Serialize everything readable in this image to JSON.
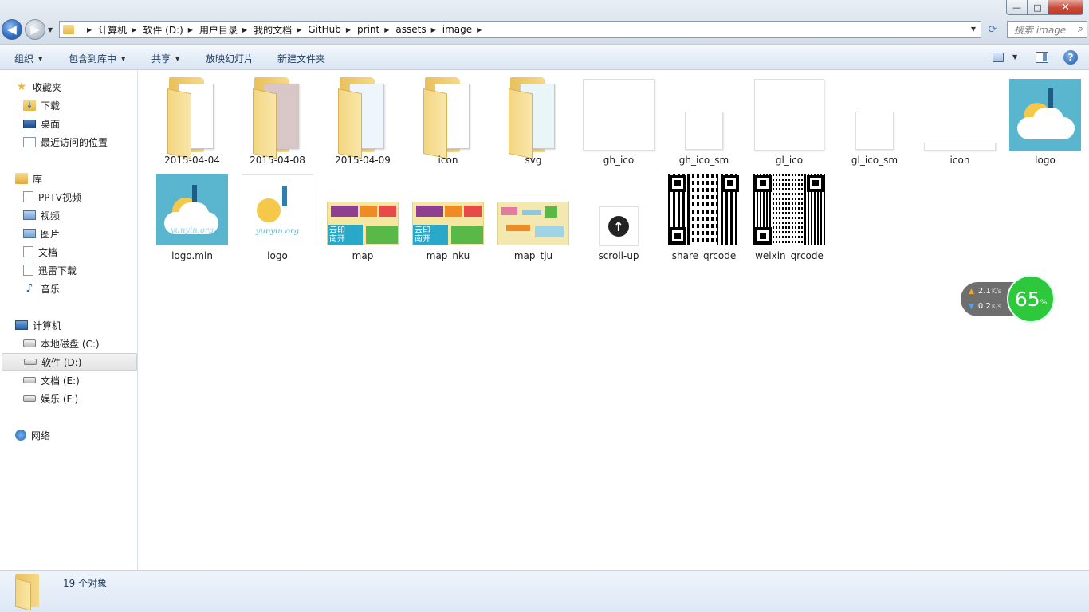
{
  "window": {
    "minimize": "—",
    "maximize": "□",
    "close": "✕"
  },
  "nav": {
    "back": "◀",
    "forward": "▶"
  },
  "breadcrumb": [
    "计算机",
    "软件 (D:)",
    "用户目录",
    "我的文档",
    "GitHub",
    "print",
    "assets",
    "image"
  ],
  "search": {
    "placeholder": "搜索 image"
  },
  "toolbar": {
    "organize": "组织",
    "include_in_library": "包含到库中",
    "share": "共享",
    "slideshow": "放映幻灯片",
    "new_folder": "新建文件夹",
    "help": "?"
  },
  "sidebar": {
    "favorites": {
      "label": "收藏夹",
      "items": [
        "下载",
        "桌面",
        "最近访问的位置"
      ]
    },
    "libraries": {
      "label": "库",
      "items": [
        "PPTV视频",
        "视频",
        "图片",
        "文档",
        "迅雷下载",
        "音乐"
      ]
    },
    "computer": {
      "label": "计算机",
      "items": [
        "本地磁盘 (C:)",
        "软件 (D:)",
        "文档 (E:)",
        "娱乐 (F:)"
      ],
      "selected": "软件 (D:)"
    },
    "network": {
      "label": "网络"
    }
  },
  "files": {
    "row1": [
      "2015-04-04",
      "2015-04-08",
      "2015-04-09",
      "icon",
      "svg",
      "gh_ico",
      "gh_ico_sm",
      "gl_ico",
      "gl_ico_sm",
      "icon",
      "logo"
    ],
    "row2": [
      "logo.min",
      "logo",
      "map",
      "map_nku",
      "map_tju",
      "scroll-up",
      "share_qrcode",
      "weixin_qrcode"
    ],
    "logo_caption": "yunyin.org"
  },
  "map_thumb_text": "云印\n南开",
  "network_widget": {
    "upload": "2.1",
    "download": "0.2",
    "unit": "K/s",
    "percent": "65",
    "percent_sign": "%"
  },
  "status": {
    "count": "19 个对象"
  }
}
